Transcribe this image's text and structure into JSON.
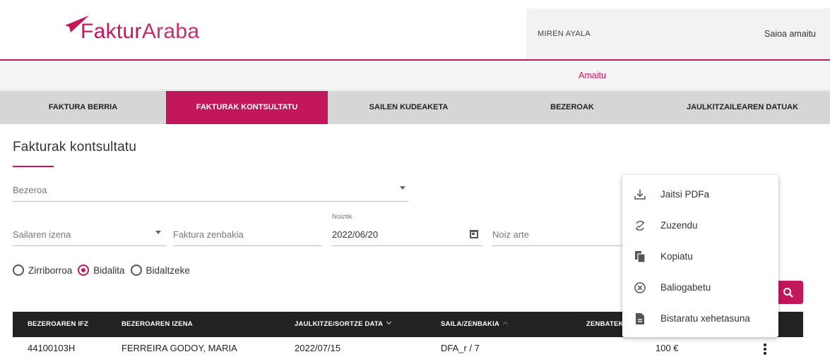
{
  "brand": {
    "name_bold": "Faktur",
    "name_light": "Araba",
    "color": "#c2185b"
  },
  "header": {
    "user_name": "MIREN AYALA",
    "logout_label": "Saioa amaitu"
  },
  "subbar": {
    "finish_label": "Amaitu"
  },
  "nav": {
    "tabs": [
      {
        "label": "FAKTURA BERRIA",
        "active": false
      },
      {
        "label": "FAKTURAK KONTSULTATU",
        "active": true
      },
      {
        "label": "SAILEN KUDEAKETA",
        "active": false
      },
      {
        "label": "BEZEROAK",
        "active": false
      },
      {
        "label": "JAULKITZAILEAREN DATUAK",
        "active": false
      }
    ]
  },
  "page": {
    "title": "Fakturak kontsultatu"
  },
  "filters": {
    "client_placeholder": "Bezeroa",
    "department_placeholder": "Sailaren izena",
    "invoice_number_placeholder": "Faktura zenbakia",
    "from_label": "Noiztik",
    "from_value": "2022/06/20",
    "to_placeholder": "Noiz arte"
  },
  "status_radios": [
    {
      "label": "Zirriborroa",
      "checked": false
    },
    {
      "label": "Bidalita",
      "checked": true
    },
    {
      "label": "Bidaltzeke",
      "checked": false
    }
  ],
  "table": {
    "headers": [
      "BEZEROAREN IFZ",
      "BEZEROAREN IZENA",
      "JAULKITZE/SORTZE DATA",
      "SAILA/ZENBAKIA",
      "ZENBATEKOA"
    ],
    "headers_visible": [
      "BEZEROAREN IFZ",
      "BEZEROAREN IZENA",
      "JAULKITZE/SORTZE DATA",
      "SAILA/ZENBAKIA",
      "ZENBATEK"
    ],
    "rows": [
      {
        "ifz": "44100103H",
        "name": "FERREIRA GODOY, MARIA",
        "date": "2022/07/15",
        "dept": "DFA_r / 7",
        "amount": "100 €"
      }
    ]
  },
  "context_menu": {
    "items": [
      {
        "label": "Jaitsi PDFa",
        "icon": "download-icon"
      },
      {
        "label": "Zuzendu",
        "icon": "sync-icon"
      },
      {
        "label": "Kopiatu",
        "icon": "copy-icon"
      },
      {
        "label": "Baliogabetu",
        "icon": "cancel-circle-icon"
      },
      {
        "label": "Bistaratu xehetasuna",
        "icon": "document-icon"
      }
    ]
  }
}
